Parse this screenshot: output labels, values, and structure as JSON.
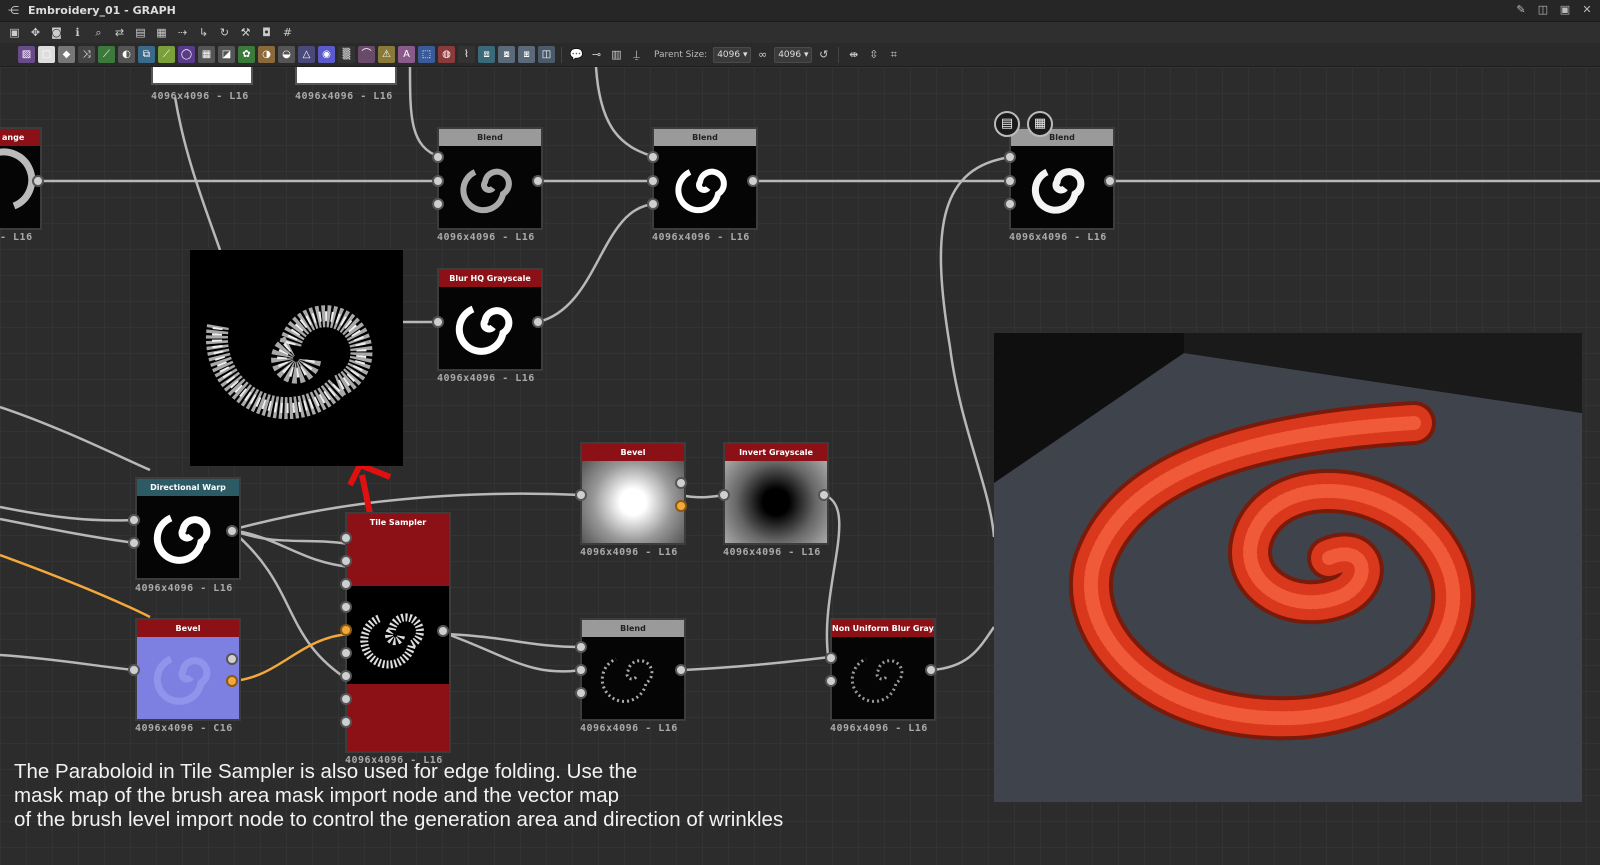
{
  "window": {
    "title": "Embroidery_01 - GRAPH",
    "title_icon": "graph-icon",
    "controls": [
      "pin-icon",
      "restore-icon",
      "maximize-icon",
      "close-icon"
    ],
    "control_glyphs": [
      "✎",
      "◫",
      "▣",
      "✕"
    ]
  },
  "toolbar1": {
    "icons": [
      "frame-icon",
      "pan-icon",
      "camera-icon",
      "info-icon",
      "zoom-icon",
      "link-icon",
      "layout-icon",
      "align-icon",
      "connect-icon",
      "route-icon",
      "refresh-icon",
      "tools-icon",
      "snapshot-icon",
      "grid-icon"
    ],
    "glyphs": [
      "▣",
      "✥",
      "◙",
      "ℹ",
      "⌕",
      "⇄",
      "▤",
      "▦",
      "⇢",
      "↳",
      "↻",
      "⚒",
      "◘",
      "#"
    ]
  },
  "toolbar2": {
    "icons": [
      {
        "name": "image-icon",
        "color": "#6a4b8a",
        "glyph": "▨"
      },
      {
        "name": "uniform-color-icon",
        "color": "#dddddd",
        "glyph": "▢"
      },
      {
        "name": "color-picker-icon",
        "color": "#777777",
        "glyph": "◆"
      },
      {
        "name": "shuffle-icon",
        "color": "#444444",
        "glyph": "⤨"
      },
      {
        "name": "curve-icon",
        "color": "#3c7a3c",
        "glyph": "⟋"
      },
      {
        "name": "levels-icon",
        "color": "#555555",
        "glyph": "◐"
      },
      {
        "name": "transform-icon",
        "color": "#3a6a8a",
        "glyph": "⧉"
      },
      {
        "name": "gradient-icon",
        "color": "#7aa03a",
        "glyph": "⟋"
      },
      {
        "name": "warp-icon",
        "color": "#5a3a8a",
        "glyph": "◯"
      },
      {
        "name": "tile-icon",
        "color": "#555555",
        "glyph": "▦"
      },
      {
        "name": "fx-map-icon",
        "color": "#555555",
        "glyph": "◪"
      },
      {
        "name": "pixel-processor-icon",
        "color": "#3a7a3a",
        "glyph": "✿"
      },
      {
        "name": "blend-icon",
        "color": "#8a6a3a",
        "glyph": "◑"
      },
      {
        "name": "histogram-icon",
        "color": "#555555",
        "glyph": "◒"
      },
      {
        "name": "sharpen-icon",
        "color": "#4a4a7a",
        "glyph": "△"
      },
      {
        "name": "hsl-icon",
        "color": "#5a5acc",
        "glyph": "◉"
      },
      {
        "name": "noise-icon",
        "color": "#333333",
        "glyph": "▒"
      },
      {
        "name": "normal-icon",
        "color": "#6a4a6a",
        "glyph": "⌒"
      },
      {
        "name": "warning-icon",
        "color": "#8a7a3a",
        "glyph": "⚠"
      },
      {
        "name": "text-icon",
        "color": "#8a5a8a",
        "glyph": "A"
      },
      {
        "name": "selection-icon",
        "color": "#3a5a9a",
        "glyph": "⬚"
      },
      {
        "name": "fill-icon",
        "color": "#8a3a3a",
        "glyph": "◍"
      },
      {
        "name": "edge-icon",
        "color": "#333333",
        "glyph": "⌇"
      },
      {
        "name": "output-icon",
        "color": "#3a6a7a",
        "glyph": "⧈"
      },
      {
        "name": "input-icon",
        "color": "#5a6a7a",
        "glyph": "⧇"
      },
      {
        "name": "frame-node-icon",
        "color": "#5a6a7a",
        "glyph": "⧆"
      },
      {
        "name": "comment-frame-icon",
        "color": "#4a5a6a",
        "glyph": "◫"
      }
    ],
    "icons_after": [
      {
        "name": "comment-icon",
        "glyph": "💬"
      },
      {
        "name": "pin-icon",
        "glyph": "⊸"
      },
      {
        "name": "graph-output-icon",
        "glyph": "▥"
      },
      {
        "name": "push-pin-icon",
        "glyph": "⍊"
      }
    ],
    "parent_size_label": "Parent Size:",
    "parent_size_value": "4096",
    "link_icon": "link-icon",
    "size_value": "4096",
    "reset_icon": "reset-icon",
    "tail_icons": [
      "arrange-icon",
      "split-icon",
      "crop-icon"
    ],
    "tail_glyphs": [
      "⇼",
      "⇳",
      "⌗"
    ],
    "glyph_link": "∞",
    "glyph_reset": "↺"
  },
  "nodes": {
    "top_left_a": {
      "label": "4096x4096 - L16"
    },
    "top_left_b": {
      "label": "4096x4096 - L16"
    },
    "range_partial": {
      "title": "ange",
      "label": "- L16"
    },
    "blend1": {
      "title": "Blend",
      "label": "4096x4096 - L16"
    },
    "blend2": {
      "title": "Blend",
      "label": "4096x4096 - L16"
    },
    "blend3": {
      "title": "Blend",
      "label": "4096x4096 - L16"
    },
    "blur_hq": {
      "title": "Blur HQ Grayscale",
      "label": "4096x4096 - L16"
    },
    "directional_warp": {
      "title": "Directional Warp",
      "label": "4096x4096 - L16"
    },
    "bevel_vec": {
      "title": "Bevel",
      "label": "4096x4096 - C16"
    },
    "tile_sampler": {
      "title": "Tile Sampler",
      "label": "4096x4096 - L16"
    },
    "bevel2": {
      "title": "Bevel",
      "label": "4096x4096 - L16"
    },
    "invert": {
      "title": "Invert Grayscale",
      "label": "4096x4096 - L16"
    },
    "blend4": {
      "title": "Blend",
      "label": "4096x4096 - L16"
    },
    "non_uniform_blur": {
      "title": "Non Uniform Blur Gray...",
      "label": "4096x4096 - L16"
    }
  },
  "badges": {
    "first": "document-icon",
    "second": "checker-icon",
    "first_glyph": "▤",
    "second_glyph": "▦"
  },
  "colors": {
    "red_header": "#8c1116",
    "teal_header": "#2c5b66",
    "gray_header": "#9a9a9a",
    "wire": "#b8b8b8",
    "vector_wire": "#f2a83a",
    "embroidery_red": "#d9381c",
    "arrow": "#e01010"
  },
  "caption": {
    "line1": "The Paraboloid in Tile Sampler is also used for edge folding. Use the",
    "line2": "mask map of the brush area mask import node and the vector map",
    "line3": "of the brush level import node to control the generation area and direction of wrinkles"
  }
}
